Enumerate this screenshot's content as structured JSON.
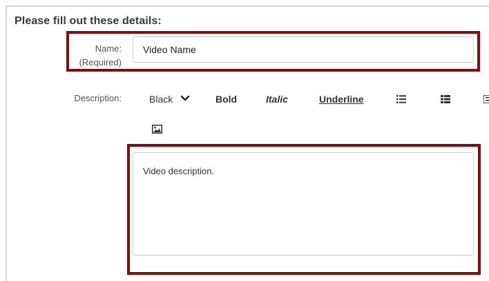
{
  "form": {
    "heading": "Please fill out these details:",
    "name_label_line1": "Name:",
    "name_label_line2": "(Required)",
    "name_value": "Video Name",
    "description_label": "Description:",
    "description_value": "Video description."
  },
  "toolbar": {
    "color_label": "Black",
    "bold_label": "Bold",
    "italic_label": "Italic",
    "underline_label": "Underline",
    "icons": [
      "chevron-down-icon",
      "bulleted-list-icon",
      "numbered-list-icon",
      "more-icon",
      "image-icon"
    ]
  },
  "colors": {
    "highlight_border": "#8b0a0a",
    "input_border": "#cfcfcf",
    "frame_border": "#d3d3d3"
  }
}
